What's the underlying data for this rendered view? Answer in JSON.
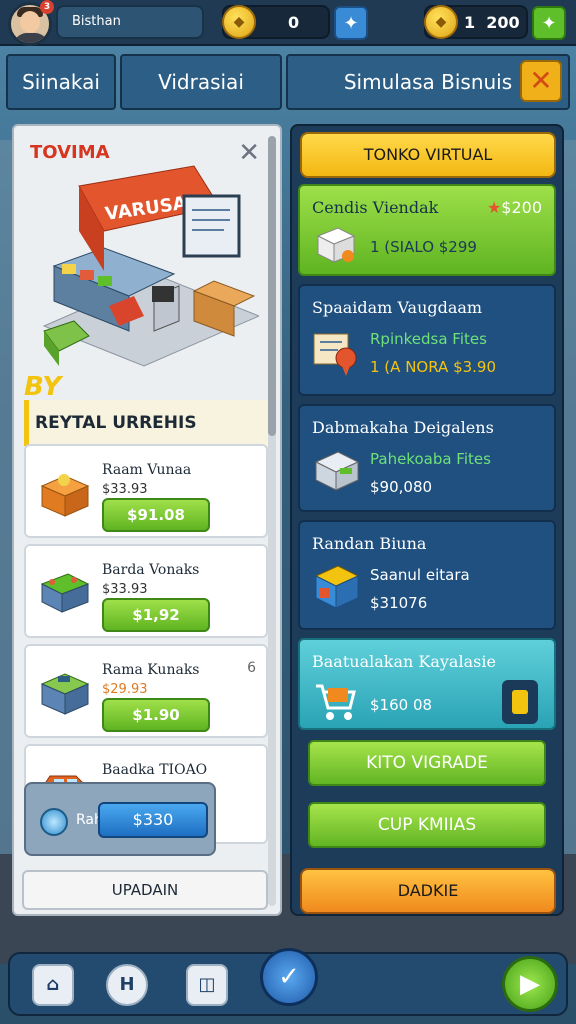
{
  "topbar": {
    "player_name": "Bisthan",
    "notification_count": "3",
    "coins_value": "0",
    "gold_value": "1  200"
  },
  "tabs": [
    "Siinakai",
    "Vidrasiai",
    "Simulasa Bisnuis"
  ],
  "shop_panel": {
    "title": "TOVIMA",
    "booth_sign": "VARUSA",
    "banner_text": "BY",
    "section_title": "REYTAL URREHIS",
    "items": [
      {
        "name": "Raam Vunaa",
        "price": "$33.93",
        "button": "$91.08"
      },
      {
        "name": "Barda Vonaks",
        "price": "$33.93",
        "button": "$1,92"
      },
      {
        "name": "Rama Kunaks",
        "price": "$29.93",
        "button": "$1.90",
        "extra": "6"
      },
      {
        "name": "Baadka TIOAO",
        "price": "",
        "button": ""
      }
    ],
    "return_card": {
      "label": "Rahten",
      "button": "$330"
    },
    "update_button": "UPADAIN"
  },
  "business_panel": {
    "header_button": "TONKO VIRTUAL",
    "cards": [
      {
        "title": "Cendis Viendak",
        "badge": "$200",
        "line": "1 (SIALO $299"
      },
      {
        "title": "Spaaidam Vaugdaam",
        "sub": "Rpinkedsa Fites",
        "line": "1 (A NORA $3.90"
      },
      {
        "title": "Dabmakaha Deigalens",
        "sub": "Pahekoaba Fites",
        "line": "$90,080"
      },
      {
        "title": "Randan Biuna",
        "sub": "Saanul eitara",
        "line": "$31076"
      },
      {
        "title": "Baatualakan Kayalasie",
        "line": "$160 08"
      }
    ],
    "buttons": [
      "KITO VIGRADE",
      "CUP KMIIAS",
      "DADKIE"
    ]
  },
  "colors": {
    "accent_yellow": "#f3c40f",
    "accent_green": "#62b524",
    "accent_blue": "#1e6fc2",
    "danger_red": "#d6361f"
  }
}
